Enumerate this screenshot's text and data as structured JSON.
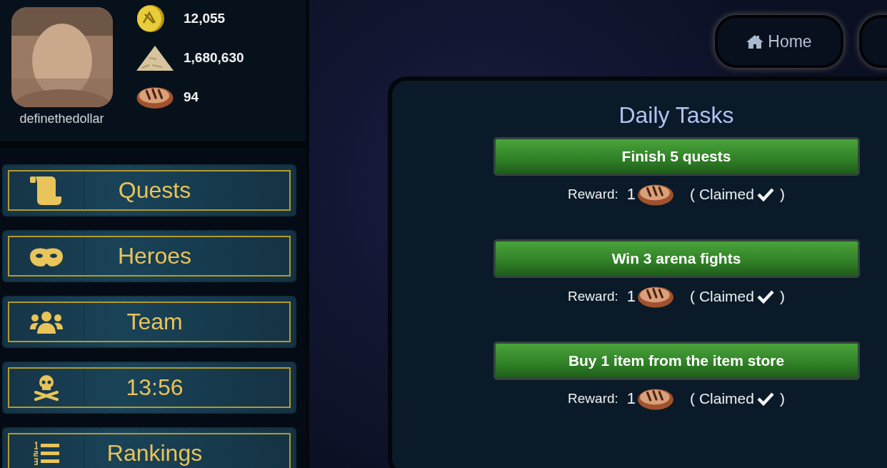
{
  "profile": {
    "username": "definethedollar"
  },
  "resources": [
    {
      "kind": "coin",
      "value": "12,055"
    },
    {
      "kind": "sand",
      "value": "1,680,630"
    },
    {
      "kind": "bread",
      "value": "94"
    }
  ],
  "menu": [
    {
      "kind": "scroll",
      "label": "Quests"
    },
    {
      "kind": "mask",
      "label": "Heroes"
    },
    {
      "kind": "people",
      "label": "Team"
    },
    {
      "kind": "skull",
      "label": "13:56"
    },
    {
      "kind": "list",
      "label": "Rankings"
    }
  ],
  "nav": [
    {
      "kind": "home",
      "label": "Home"
    },
    {
      "kind": "blank"
    }
  ],
  "daily_tasks": {
    "title": "Daily Tasks",
    "tasks": [
      {
        "label": "Finish 5 quests",
        "reward_label": "Reward:",
        "reward_amount": "1",
        "claimed_text": "( Claimed",
        "claimed_close": ")",
        "claimed": true
      },
      {
        "label": "Win 3 arena fights",
        "reward_label": "Reward:",
        "reward_amount": "1",
        "claimed_text": "( Claimed",
        "claimed_close": ")",
        "claimed": true
      },
      {
        "label": "Buy 1 item from the item store",
        "reward_label": "Reward:",
        "reward_amount": "1",
        "claimed_text": "( Claimed",
        "claimed_close": ")",
        "claimed": true
      }
    ]
  }
}
